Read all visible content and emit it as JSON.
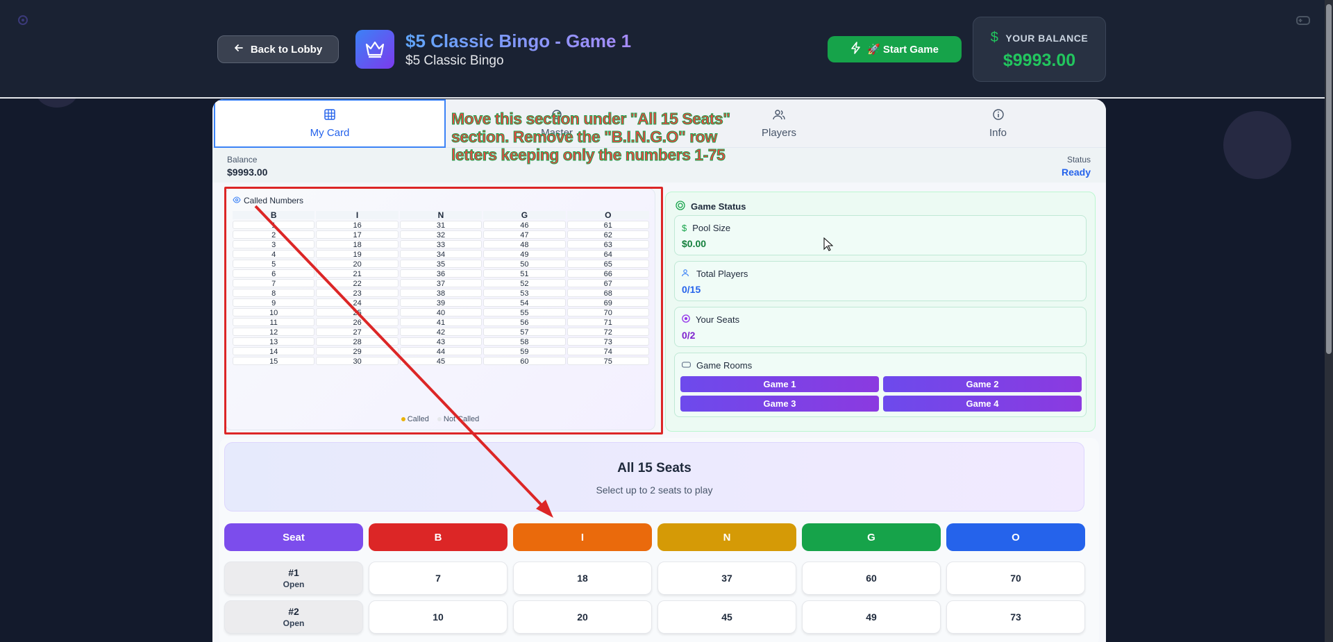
{
  "header": {
    "back_label": "Back to Lobby",
    "title": "$5 Classic Bingo - Game 1",
    "subtitle": "$5 Classic Bingo",
    "start_label": "🚀 Start Game",
    "balance_label": "YOUR BALANCE",
    "balance_value": "$9993.00"
  },
  "tabs": [
    {
      "label": "My Card",
      "icon": "grid-icon",
      "active": true
    },
    {
      "label": "Master",
      "icon": "eye-icon",
      "active": false
    },
    {
      "label": "Players",
      "icon": "users-icon",
      "active": false
    },
    {
      "label": "Info",
      "icon": "info-icon",
      "active": false
    }
  ],
  "info_row": {
    "balance_label": "Balance",
    "balance_value": "$9993.00",
    "status_label": "Status",
    "status_value": "Ready"
  },
  "called_numbers": {
    "title": "Called Numbers",
    "columns": [
      "B",
      "I",
      "N",
      "G",
      "O"
    ],
    "rows": [
      [
        "1",
        "16",
        "31",
        "46",
        "61"
      ],
      [
        "2",
        "17",
        "32",
        "47",
        "62"
      ],
      [
        "3",
        "18",
        "33",
        "48",
        "63"
      ],
      [
        "4",
        "19",
        "34",
        "49",
        "64"
      ],
      [
        "5",
        "20",
        "35",
        "50",
        "65"
      ],
      [
        "6",
        "21",
        "36",
        "51",
        "66"
      ],
      [
        "7",
        "22",
        "37",
        "52",
        "67"
      ],
      [
        "8",
        "23",
        "38",
        "53",
        "68"
      ],
      [
        "9",
        "24",
        "39",
        "54",
        "69"
      ],
      [
        "10",
        "25",
        "40",
        "55",
        "70"
      ],
      [
        "11",
        "26",
        "41",
        "56",
        "71"
      ],
      [
        "12",
        "27",
        "42",
        "57",
        "72"
      ],
      [
        "13",
        "28",
        "43",
        "58",
        "73"
      ],
      [
        "14",
        "29",
        "44",
        "59",
        "74"
      ],
      [
        "15",
        "30",
        "45",
        "60",
        "75"
      ]
    ],
    "legend_called": "Called",
    "legend_not_called": "Not Called"
  },
  "game_status": {
    "title": "Game Status",
    "pool_label": "Pool Size",
    "pool_value": "$0.00",
    "players_label": "Total Players",
    "players_value": "0/15",
    "seats_label": "Your Seats",
    "seats_value": "0/2",
    "rooms_label": "Game Rooms",
    "rooms": [
      "Game 1",
      "Game 2",
      "Game 3",
      "Game 4"
    ]
  },
  "seats": {
    "title": "All 15 Seats",
    "subtitle": "Select up to 2 seats to play",
    "columns": [
      "Seat",
      "B",
      "I",
      "N",
      "G",
      "O"
    ],
    "column_colors": [
      "#7c4dec",
      "#dc2626",
      "#ea6a0c",
      "#d59a06",
      "#16a34a",
      "#2563eb"
    ],
    "rows": [
      {
        "seat": "#1",
        "status": "Open",
        "values": [
          "7",
          "18",
          "37",
          "60",
          "70"
        ]
      },
      {
        "seat": "#2",
        "status": "Open",
        "values": [
          "10",
          "20",
          "45",
          "49",
          "73"
        ]
      }
    ]
  },
  "annotation": {
    "text": "Move this section under \"All 15 Seats\" section. Remove the \"B.I.N.G.O\" row letters keeping only the numbers 1-75"
  },
  "colors": {
    "accent": "#2563eb",
    "balance_green": "#22c55e",
    "annotation_red": "#dc2626"
  }
}
